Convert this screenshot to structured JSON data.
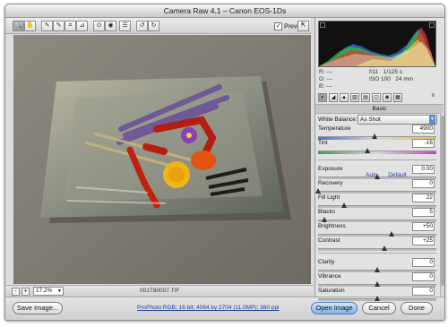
{
  "window": {
    "title": "Camera Raw 4.1  –  Canon EOS-1Ds"
  },
  "toolbar": {
    "tools": [
      {
        "icon": "zoom-icon",
        "glyph": "🔍"
      },
      {
        "icon": "hand-icon",
        "glyph": "✋"
      },
      {
        "icon": "white-balance-icon",
        "glyph": "✎"
      },
      {
        "icon": "color-sampler-icon",
        "glyph": "✎"
      },
      {
        "icon": "crop-icon",
        "glyph": "⌗"
      },
      {
        "icon": "straighten-icon",
        "glyph": "⊿"
      },
      {
        "icon": "retouch-icon",
        "glyph": "⊙"
      },
      {
        "icon": "red-eye-icon",
        "glyph": "◉"
      },
      {
        "icon": "preferences-icon",
        "glyph": "☰"
      },
      {
        "icon": "rotate-left-icon",
        "glyph": "↺"
      },
      {
        "icon": "rotate-right-icon",
        "glyph": "↻"
      }
    ],
    "preview_label": "Preview",
    "preview_checked": "✓",
    "fullscreen_glyph": "⇱"
  },
  "status": {
    "zoom_out": "-",
    "zoom_in": "+",
    "zoom_value": "17.2%",
    "filename": "001T80007.TIF"
  },
  "bottom": {
    "save_label": "Save Image...",
    "workflow_link": "ProPhoto RGB; 16 bit; 4064 by 2704 (11.0MP); 360 ppi",
    "open_label": "Open Image",
    "cancel_label": "Cancel",
    "done_label": "Done"
  },
  "histogram": {
    "readout": {
      "r": "R:",
      "g": "G:",
      "b": "B:",
      "r_val": "---",
      "g_val": "---",
      "b_val": "---"
    },
    "aperture": "f/11",
    "shutter": "1/125 s",
    "iso": "ISO 100",
    "focal": "24 mm"
  },
  "panel": {
    "section_title": "Basic",
    "white_balance_label": "White Balance:",
    "white_balance_value": "As Shot",
    "auto_link": "Auto",
    "default_link": "Default",
    "sliders": [
      {
        "label": "Temperature",
        "value": "4900",
        "pos": 0.48,
        "kind": "temp"
      },
      {
        "label": "Tint",
        "value": "-16",
        "pos": 0.42,
        "kind": "tint"
      },
      {
        "label": "Exposure",
        "value": "0.00",
        "pos": 0.5,
        "kind": "plain"
      },
      {
        "label": "Recovery",
        "value": "0",
        "pos": 0.0,
        "kind": "plain"
      },
      {
        "label": "Fill Light",
        "value": "22",
        "pos": 0.22,
        "kind": "plain"
      },
      {
        "label": "Blacks",
        "value": "5",
        "pos": 0.05,
        "kind": "plain"
      },
      {
        "label": "Brightness",
        "value": "+50",
        "pos": 0.62,
        "kind": "plain"
      },
      {
        "label": "Contrast",
        "value": "+25",
        "pos": 0.56,
        "kind": "plain"
      },
      {
        "label": "Clarity",
        "value": "0",
        "pos": 0.5,
        "kind": "plain"
      },
      {
        "label": "Vibrance",
        "value": "0",
        "pos": 0.5,
        "kind": "plain"
      },
      {
        "label": "Saturation",
        "value": "0",
        "pos": 0.5,
        "kind": "plain"
      }
    ]
  }
}
